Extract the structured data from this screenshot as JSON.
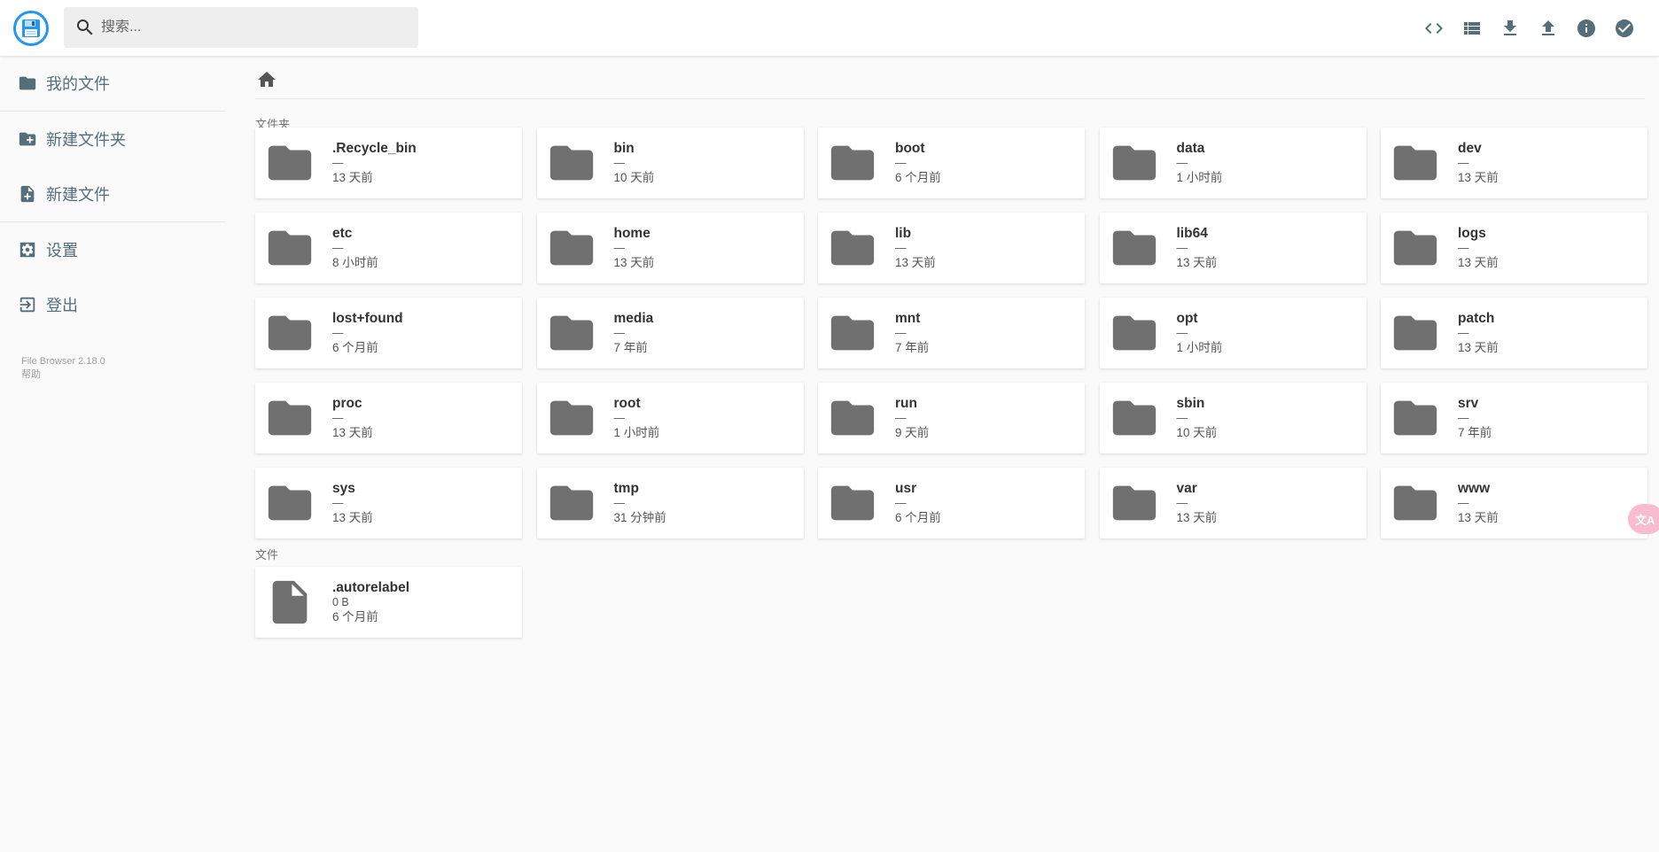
{
  "search": {
    "placeholder": "搜索..."
  },
  "toolbar": [
    {
      "name": "toggle-code-view-button",
      "icon": "code-icon"
    },
    {
      "name": "switch-view-button",
      "icon": "view-list-icon"
    },
    {
      "name": "download-button",
      "icon": "download-icon"
    },
    {
      "name": "upload-button",
      "icon": "upload-icon"
    },
    {
      "name": "info-button",
      "icon": "info-icon"
    },
    {
      "name": "select-multiple-button",
      "icon": "check-circle-icon"
    }
  ],
  "sidebar": {
    "items": [
      {
        "label": "我的文件",
        "icon": "folder-icon"
      },
      {
        "label": "新建文件夹",
        "icon": "create-new-folder-icon"
      },
      {
        "label": "新建文件",
        "icon": "note-add-icon"
      },
      {
        "label": "设置",
        "icon": "settings-icon"
      },
      {
        "label": "登出",
        "icon": "logout-icon"
      }
    ],
    "credits": {
      "version": "File Browser 2.18.0",
      "help": "帮助"
    }
  },
  "breadcrumb": {
    "home_icon": "home-icon"
  },
  "sections": {
    "folders": "文件夹",
    "files": "文件"
  },
  "folders": [
    {
      "name": ".Recycle_bin",
      "size": "—",
      "time": "13 天前"
    },
    {
      "name": "bin",
      "size": "—",
      "time": "10 天前"
    },
    {
      "name": "boot",
      "size": "—",
      "time": "6 个月前"
    },
    {
      "name": "data",
      "size": "—",
      "time": "1 小时前"
    },
    {
      "name": "dev",
      "size": "—",
      "time": "13 天前"
    },
    {
      "name": "etc",
      "size": "—",
      "time": "8 小时前"
    },
    {
      "name": "home",
      "size": "—",
      "time": "13 天前"
    },
    {
      "name": "lib",
      "size": "—",
      "time": "13 天前"
    },
    {
      "name": "lib64",
      "size": "—",
      "time": "13 天前"
    },
    {
      "name": "logs",
      "size": "—",
      "time": "13 天前"
    },
    {
      "name": "lost+found",
      "size": "—",
      "time": "6 个月前"
    },
    {
      "name": "media",
      "size": "—",
      "time": "7 年前"
    },
    {
      "name": "mnt",
      "size": "—",
      "time": "7 年前"
    },
    {
      "name": "opt",
      "size": "—",
      "time": "1 小时前"
    },
    {
      "name": "patch",
      "size": "—",
      "time": "13 天前"
    },
    {
      "name": "proc",
      "size": "—",
      "time": "13 天前"
    },
    {
      "name": "root",
      "size": "—",
      "time": "1 小时前"
    },
    {
      "name": "run",
      "size": "—",
      "time": "9 天前"
    },
    {
      "name": "sbin",
      "size": "—",
      "time": "10 天前"
    },
    {
      "name": "srv",
      "size": "—",
      "time": "7 年前"
    },
    {
      "name": "sys",
      "size": "—",
      "time": "13 天前"
    },
    {
      "name": "tmp",
      "size": "—",
      "time": "31 分钟前"
    },
    {
      "name": "usr",
      "size": "—",
      "time": "6 个月前"
    },
    {
      "name": "var",
      "size": "—",
      "time": "13 天前"
    },
    {
      "name": "www",
      "size": "—",
      "time": "13 天前"
    }
  ],
  "files": [
    {
      "name": ".autorelabel",
      "size": "0 B",
      "time": "6 个月前"
    }
  ],
  "colors": {
    "accent": "#2196f3",
    "icon": "#546e7a",
    "item_icon": "#707070"
  }
}
